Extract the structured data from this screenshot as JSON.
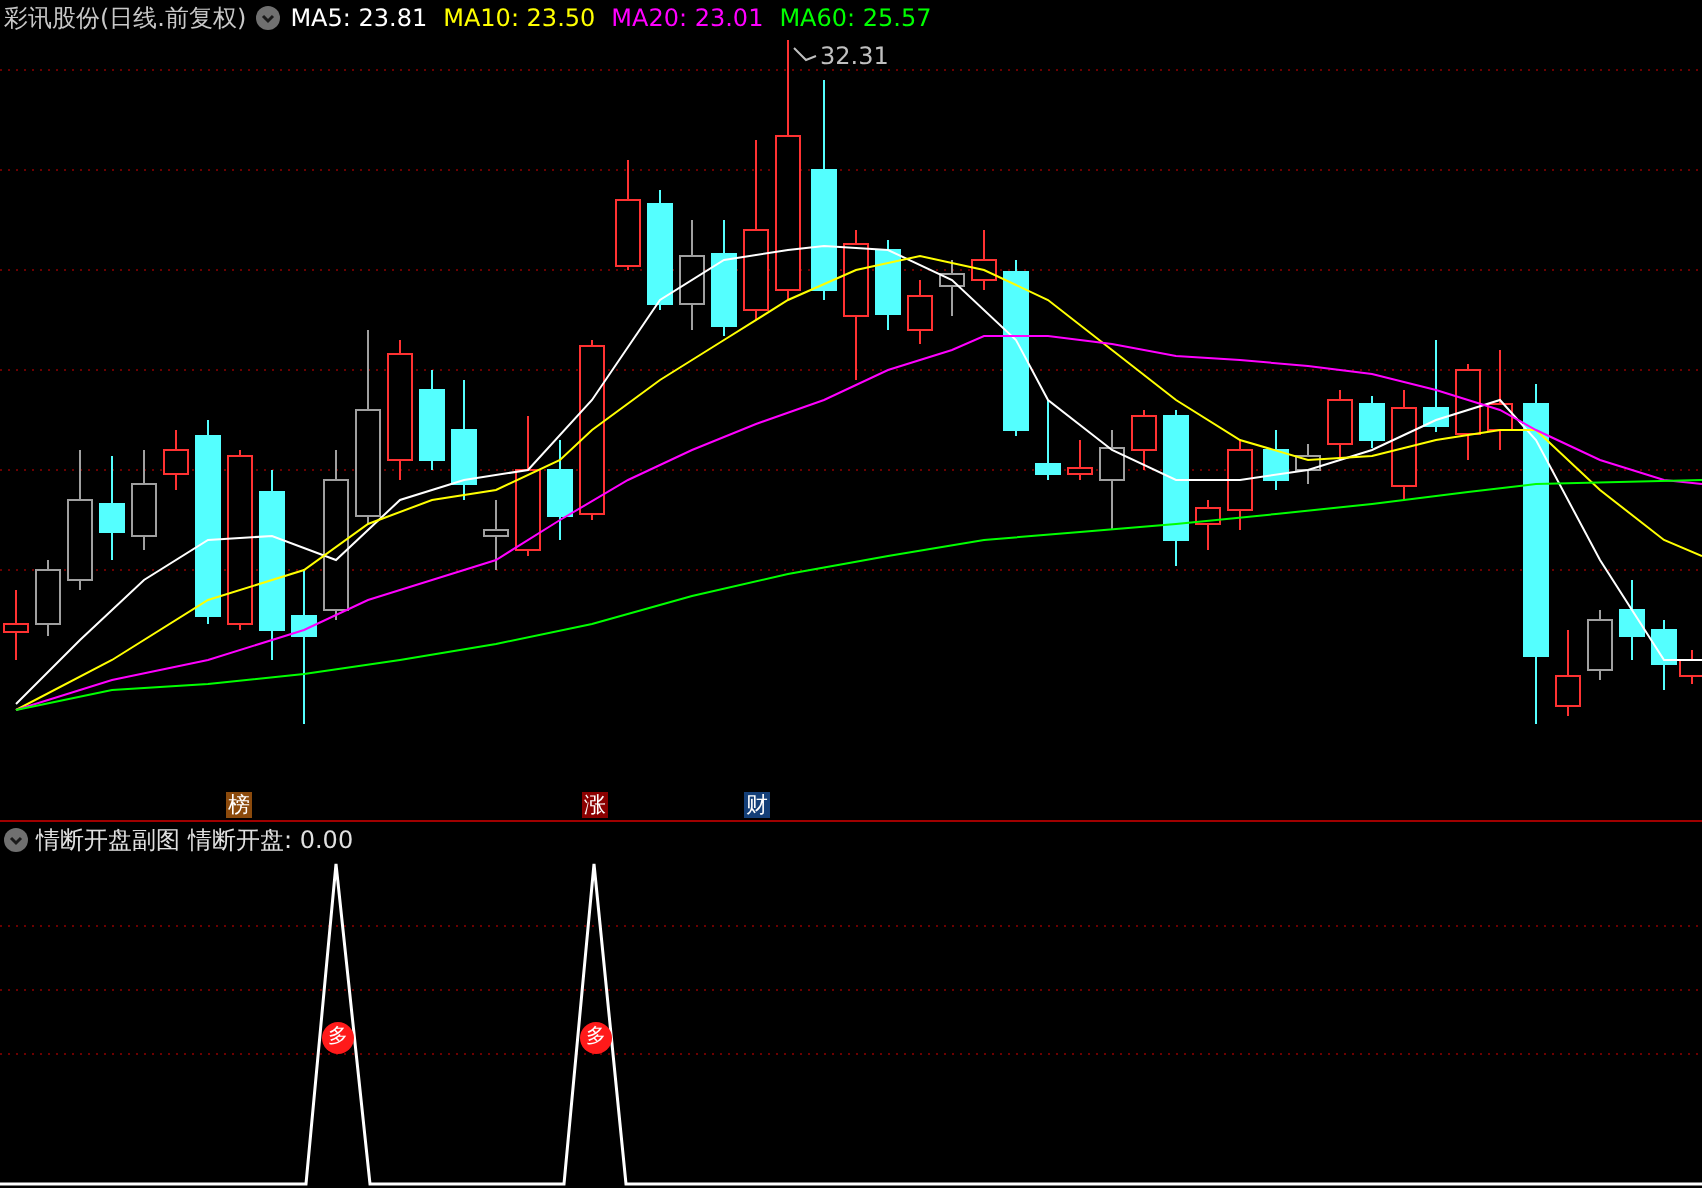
{
  "chart": {
    "title": "彩讯股份(日线.前复权)",
    "indicators": [
      {
        "label": "MA5: 23.81",
        "color": "#ffffff"
      },
      {
        "label": "MA10: 23.50",
        "color": "#ffff00"
      },
      {
        "label": "MA20: 23.01",
        "color": "#ff00ff"
      },
      {
        "label": "MA60: 25.57",
        "color": "#00ff00"
      }
    ],
    "high_label": "32.31",
    "badges": [
      {
        "text": "榜",
        "color": "#8b4a0c"
      },
      {
        "text": "涨",
        "color": "#8b0000"
      },
      {
        "text": "财",
        "color": "#143f78"
      }
    ]
  },
  "sub_chart": {
    "title": "情断开盘副图",
    "indicator": "情断开盘: 0.00",
    "markers": [
      "多",
      "多"
    ]
  }
}
